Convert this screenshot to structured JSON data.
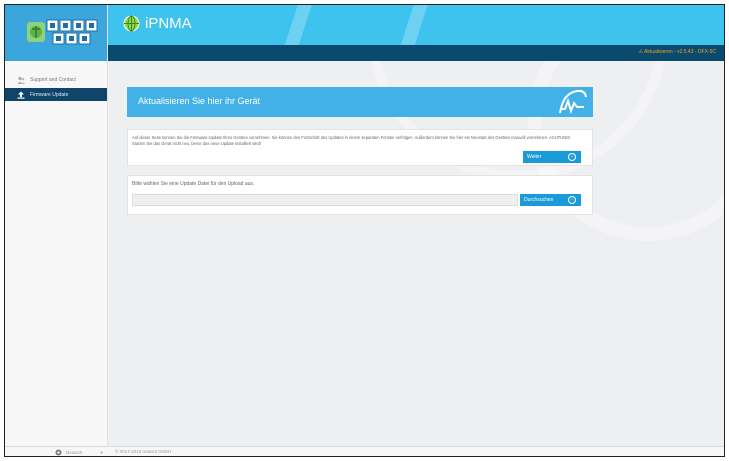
{
  "app": {
    "title": "iPNMA"
  },
  "status": {
    "text": "Aktualisieren - v2.5.43 - DFX-5C"
  },
  "sidebar": {
    "items": [
      {
        "label": "Support and Contact",
        "icon": "people-icon",
        "active": false
      },
      {
        "label": "Firmware Update",
        "icon": "upload-icon",
        "active": true
      }
    ]
  },
  "banner": {
    "heading": "Aktualisieren Sie hier ihr Gerät"
  },
  "update_card": {
    "description": "Auf dieser Seite können Sie die Firmware-Update Ihres Gerätes vornehmen. Sie können den Fortschritt des Updates in einem separaten Fenster verfolgen. Außerdem können Sie hier ein Neustart des Gerätes manuell vornehmen. ACHTUNG! Starten Sie das Gerät nicht neu, bevor das neue Update installiert wird!",
    "button_label": "Weiter"
  },
  "upload_card": {
    "label": "Bitte wählen Sie eine Update Datei für den Upload aus.",
    "file_value": "",
    "button_label": "Durchsuchen"
  },
  "footer": {
    "language": "Deutsch",
    "copyright": "© 2017-2019 Indasol GmbH"
  },
  "colors": {
    "topbar": "#3ec2ee",
    "subbar": "#0b4a6f",
    "sidebar_active": "#11446b",
    "banner": "#42b1e8",
    "button": "#1a9ad6",
    "status": "#f0a01a"
  }
}
